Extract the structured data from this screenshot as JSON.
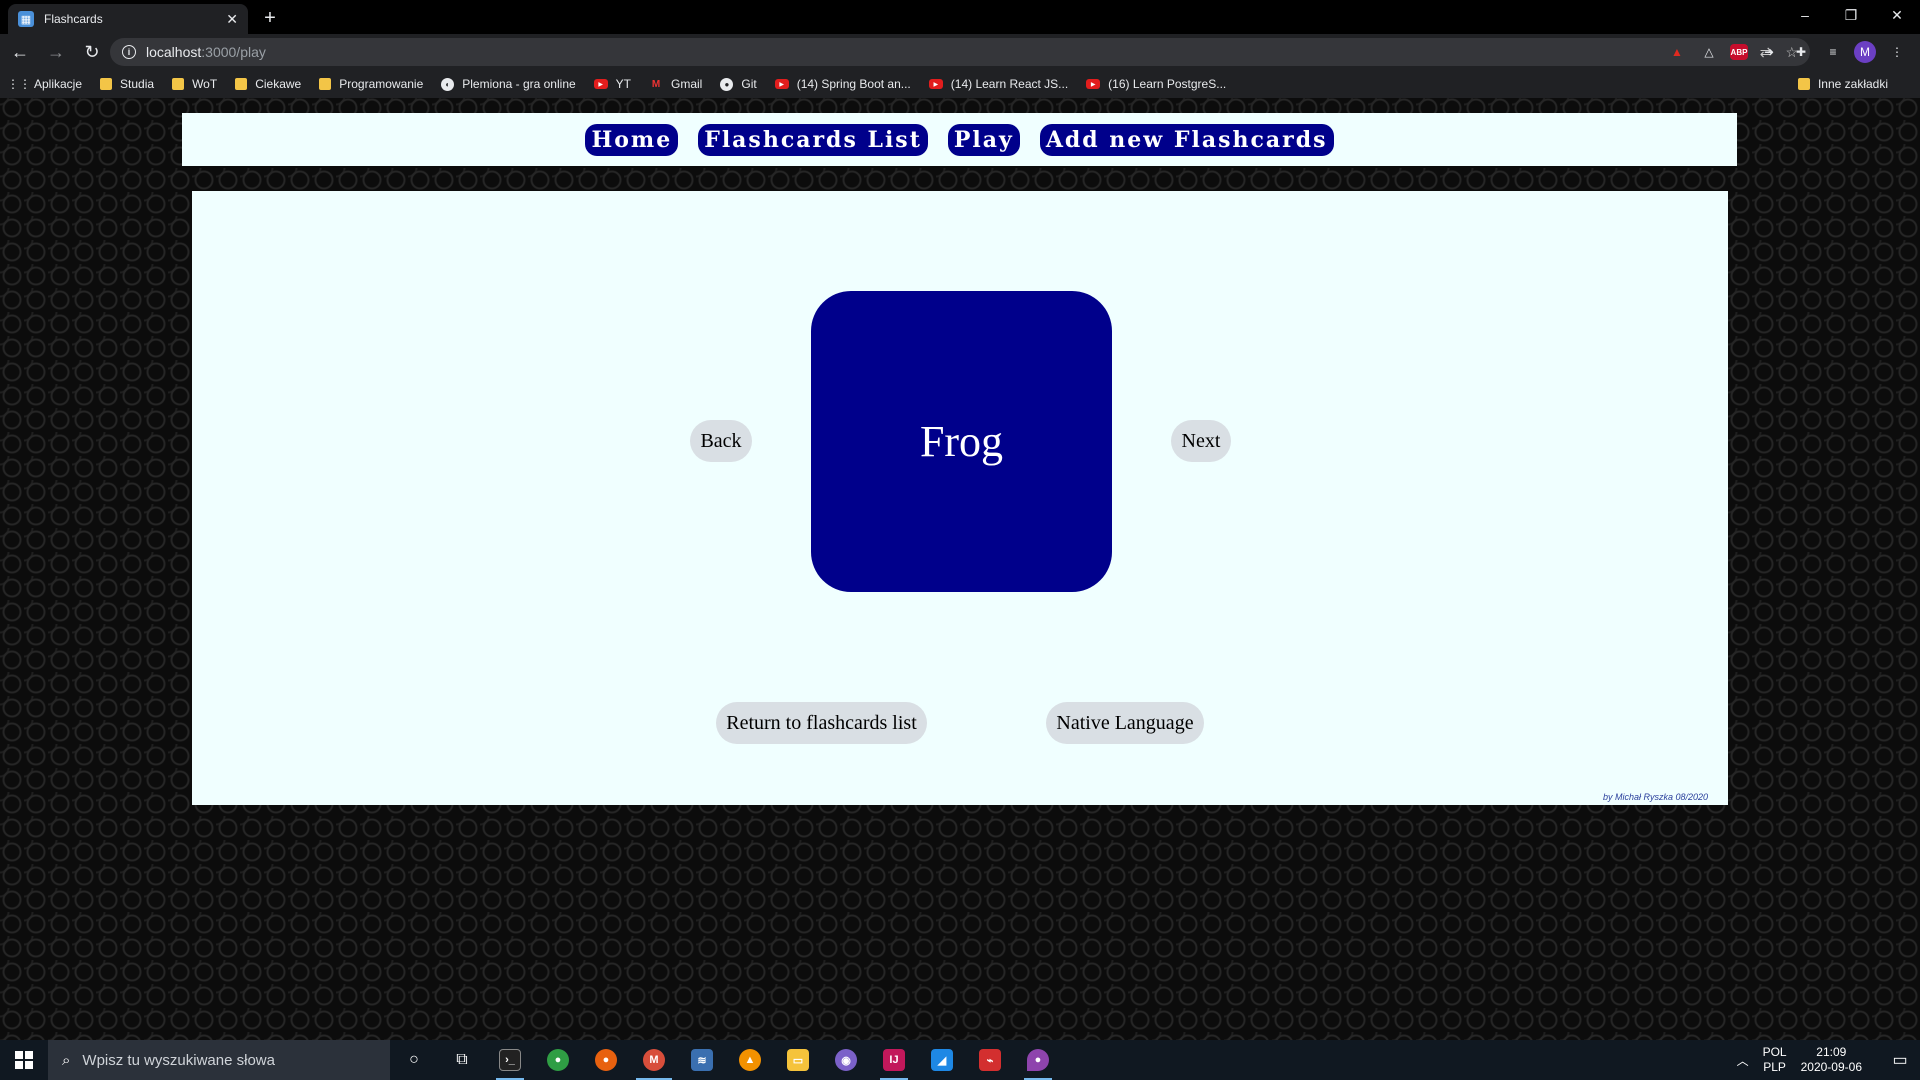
{
  "browser": {
    "tab_title": "Flashcards",
    "tab_icon": "flashcards-favicon",
    "url_host": "localhost",
    "url_path": ":3000/play",
    "profile_initial": "M",
    "abp_label": "ABP"
  },
  "bookmarks": {
    "items": [
      {
        "label": "Aplikacje",
        "icon": "apps-grid-icon"
      },
      {
        "label": "Studia",
        "icon": "folder-icon"
      },
      {
        "label": "WoT",
        "icon": "folder-icon"
      },
      {
        "label": "Ciekawe",
        "icon": "folder-icon"
      },
      {
        "label": "Programowanie",
        "icon": "folder-icon"
      },
      {
        "label": "Plemiona - gra online",
        "icon": "plemiona-icon"
      },
      {
        "label": "YT",
        "icon": "youtube-icon"
      },
      {
        "label": "Gmail",
        "icon": "gmail-icon"
      },
      {
        "label": "Git",
        "icon": "github-icon"
      },
      {
        "label": "(14) Spring Boot an...",
        "icon": "youtube-icon"
      },
      {
        "label": "(14) Learn React JS...",
        "icon": "youtube-icon"
      },
      {
        "label": "(16) Learn PostgreS...",
        "icon": "youtube-icon"
      }
    ],
    "other": "Inne zakładki"
  },
  "nav": {
    "home": "Home",
    "list": "Flashcards List",
    "play": "Play",
    "add": "Add new Flashcards"
  },
  "play": {
    "card_word": "Frog",
    "back": "Back",
    "next": "Next",
    "return": "Return to flashcards list",
    "native": "Native Language"
  },
  "footer": "by Michał Ryszka 08/2020",
  "taskbar": {
    "search_placeholder": "Wpisz tu wyszukiwane słowa",
    "lang_top": "POL",
    "lang_bottom": "PLP",
    "time": "21:09",
    "date": "2020-09-06"
  },
  "colors": {
    "accent": "#00008b",
    "panel_bg": "#f0ffff",
    "button_bg": "#d9dfe4"
  }
}
